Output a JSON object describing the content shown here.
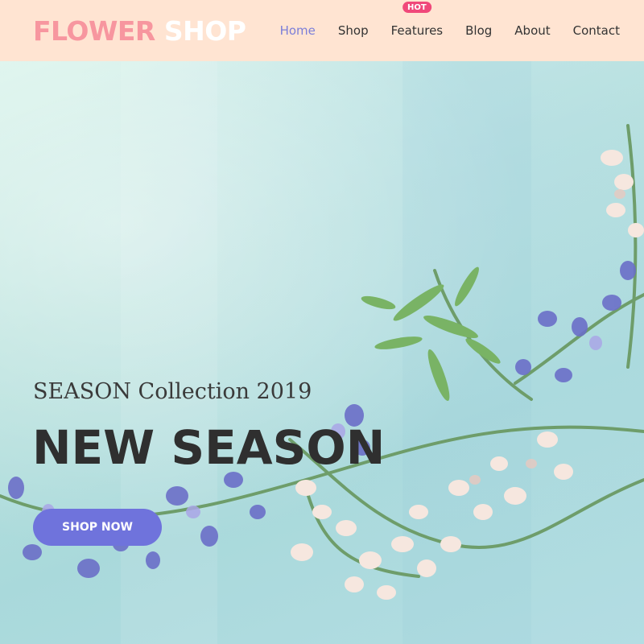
{
  "header": {
    "logo_first": "FLOWER",
    "logo_second": "SHOP",
    "nav": [
      {
        "label": "Home",
        "active": true
      },
      {
        "label": "Shop"
      },
      {
        "label": "Features",
        "badge": "HOT"
      },
      {
        "label": "Blog"
      },
      {
        "label": "About"
      },
      {
        "label": "Contact"
      }
    ]
  },
  "hero": {
    "subtitle": "SEASON Collection 2019",
    "headline": "NEW SEASON",
    "button_label": "SHOP NOW"
  },
  "colors": {
    "header_bg": "#ffe4d2",
    "logo_pink": "#f7969f",
    "nav_active": "#7b7ed9",
    "badge": "#f0487a",
    "button": "#6f73dc"
  }
}
